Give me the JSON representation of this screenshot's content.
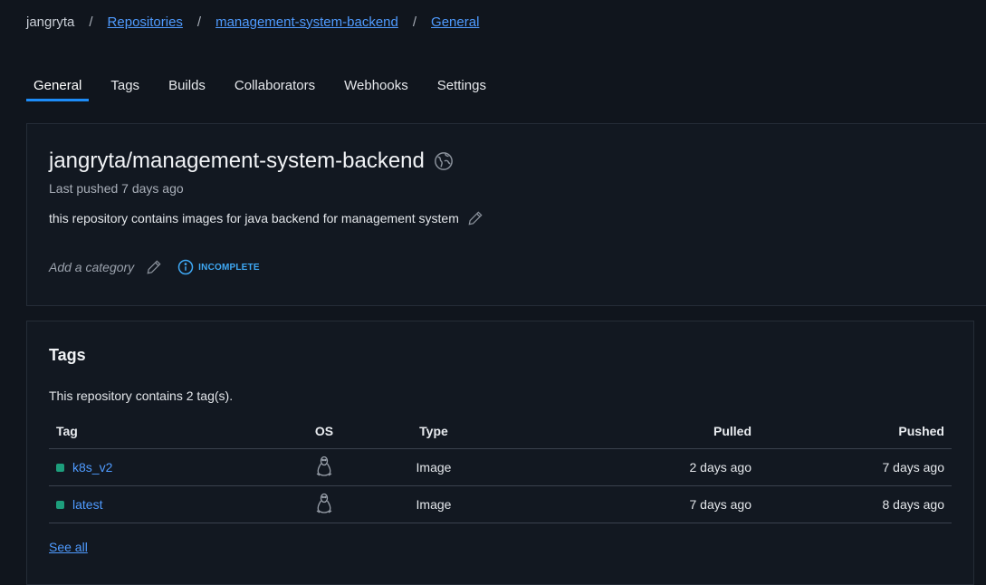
{
  "breadcrumb": {
    "user": "jangryta",
    "repositories": "Repositories",
    "repo": "management-system-backend",
    "current": "General",
    "separator": "/"
  },
  "tabs": [
    "General",
    "Tags",
    "Builds",
    "Collaborators",
    "Webhooks",
    "Settings"
  ],
  "repo": {
    "title": "jangryta/management-system-backend",
    "last_pushed": "Last pushed 7 days ago",
    "description": "this repository contains images for java backend for management system",
    "category_placeholder": "Add a category",
    "status": "INCOMPLETE"
  },
  "tags_section": {
    "heading": "Tags",
    "count_text": "This repository contains 2 tag(s).",
    "columns": {
      "tag": "Tag",
      "os": "OS",
      "type": "Type",
      "pulled": "Pulled",
      "pushed": "Pushed"
    },
    "rows": [
      {
        "tag": "k8s_v2",
        "os_icon": "linux-icon",
        "type": "Image",
        "pulled": "2 days ago",
        "pushed": "7 days ago"
      },
      {
        "tag": "latest",
        "os_icon": "linux-icon",
        "type": "Image",
        "pulled": "7 days ago",
        "pushed": "8 days ago"
      }
    ],
    "see_all": "See all"
  },
  "colors": {
    "background": "#10151d",
    "link": "#4f9bff",
    "accent": "#1d8cf8",
    "status": "#3fa9f5",
    "tag_dot": "#1d9e7c"
  }
}
